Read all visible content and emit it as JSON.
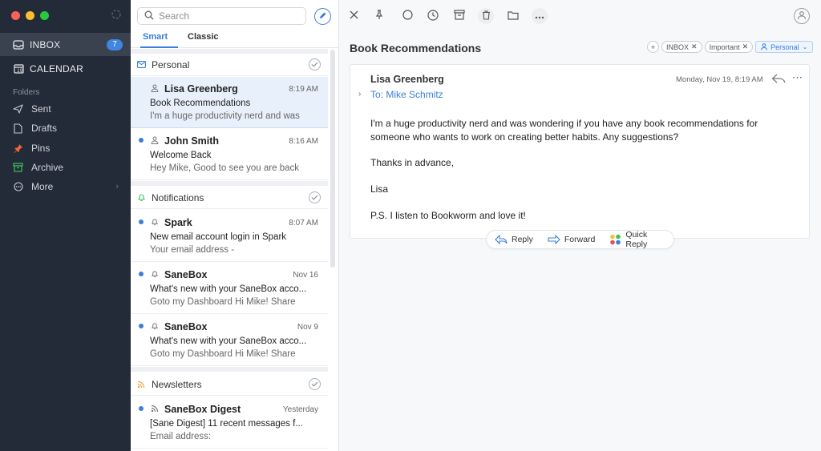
{
  "colors": {
    "sidebar_bg": "#242b38",
    "accent": "#3a7fd9",
    "close": "#ff5f57",
    "minimize": "#febc2e",
    "zoom": "#28c840"
  },
  "sidebar": {
    "inbox": {
      "label": "INBOX",
      "count": "7"
    },
    "calendar": {
      "label": "CALENDAR"
    },
    "folders_header": "Folders",
    "folders": [
      {
        "label": "Sent",
        "icon": "send-icon"
      },
      {
        "label": "Drafts",
        "icon": "draft-icon"
      },
      {
        "label": "Pins",
        "icon": "pin-icon"
      },
      {
        "label": "Archive",
        "icon": "archive-icon"
      },
      {
        "label": "More",
        "icon": "more-icon"
      }
    ]
  },
  "list": {
    "search_placeholder": "Search",
    "tabs": [
      {
        "label": "Smart"
      },
      {
        "label": "Classic"
      }
    ],
    "groups": [
      {
        "title": "Personal",
        "items": [
          {
            "sender": "Lisa Greenberg",
            "time": "8:19 AM",
            "subject": "Book Recommendations",
            "preview": "I'm a huge productivity nerd and was",
            "unread": false
          },
          {
            "sender": "John Smith",
            "time": "8:16 AM",
            "subject": "Welcome Back",
            "preview": "Hey Mike, Good to see you are back",
            "unread": true
          }
        ]
      },
      {
        "title": "Notifications",
        "items": [
          {
            "sender": "Spark",
            "time": "8:07 AM",
            "subject": "New email account login in Spark",
            "preview": "Your email address -",
            "unread": true
          },
          {
            "sender": "SaneBox",
            "time": "Nov 16",
            "subject": "What's new with your SaneBox acco...",
            "preview": "Goto my Dashboard Hi Mike! Share",
            "unread": true
          },
          {
            "sender": "SaneBox",
            "time": "Nov 9",
            "subject": "What's new with your SaneBox acco...",
            "preview": "Goto my Dashboard Hi Mike! Share",
            "unread": true
          }
        ]
      },
      {
        "title": "Newsletters",
        "items": [
          {
            "sender": "SaneBox Digest",
            "time": "Yesterday",
            "subject": "[Sane Digest] 11 recent messages f...",
            "preview": "Email address:",
            "unread": true
          }
        ]
      }
    ]
  },
  "reader": {
    "title": "Book Recommendations",
    "tags": [
      {
        "label": "INBOX"
      },
      {
        "label": "Important"
      }
    ],
    "personal_label": "Personal",
    "from": "Lisa Greenberg",
    "date": "Monday, Nov 19, 8:19 AM",
    "to": "To: Mike Schmitz",
    "body": [
      "I'm a huge productivity nerd and was wondering if you have any book recommendations for someone who wants to work on creating better habits. Any suggestions?",
      "Thanks in advance,",
      "Lisa",
      "P.S. I listen to Bookworm and love it!"
    ],
    "actions": {
      "reply": "Reply",
      "forward": "Forward",
      "quick_reply": "Quick Reply"
    }
  }
}
